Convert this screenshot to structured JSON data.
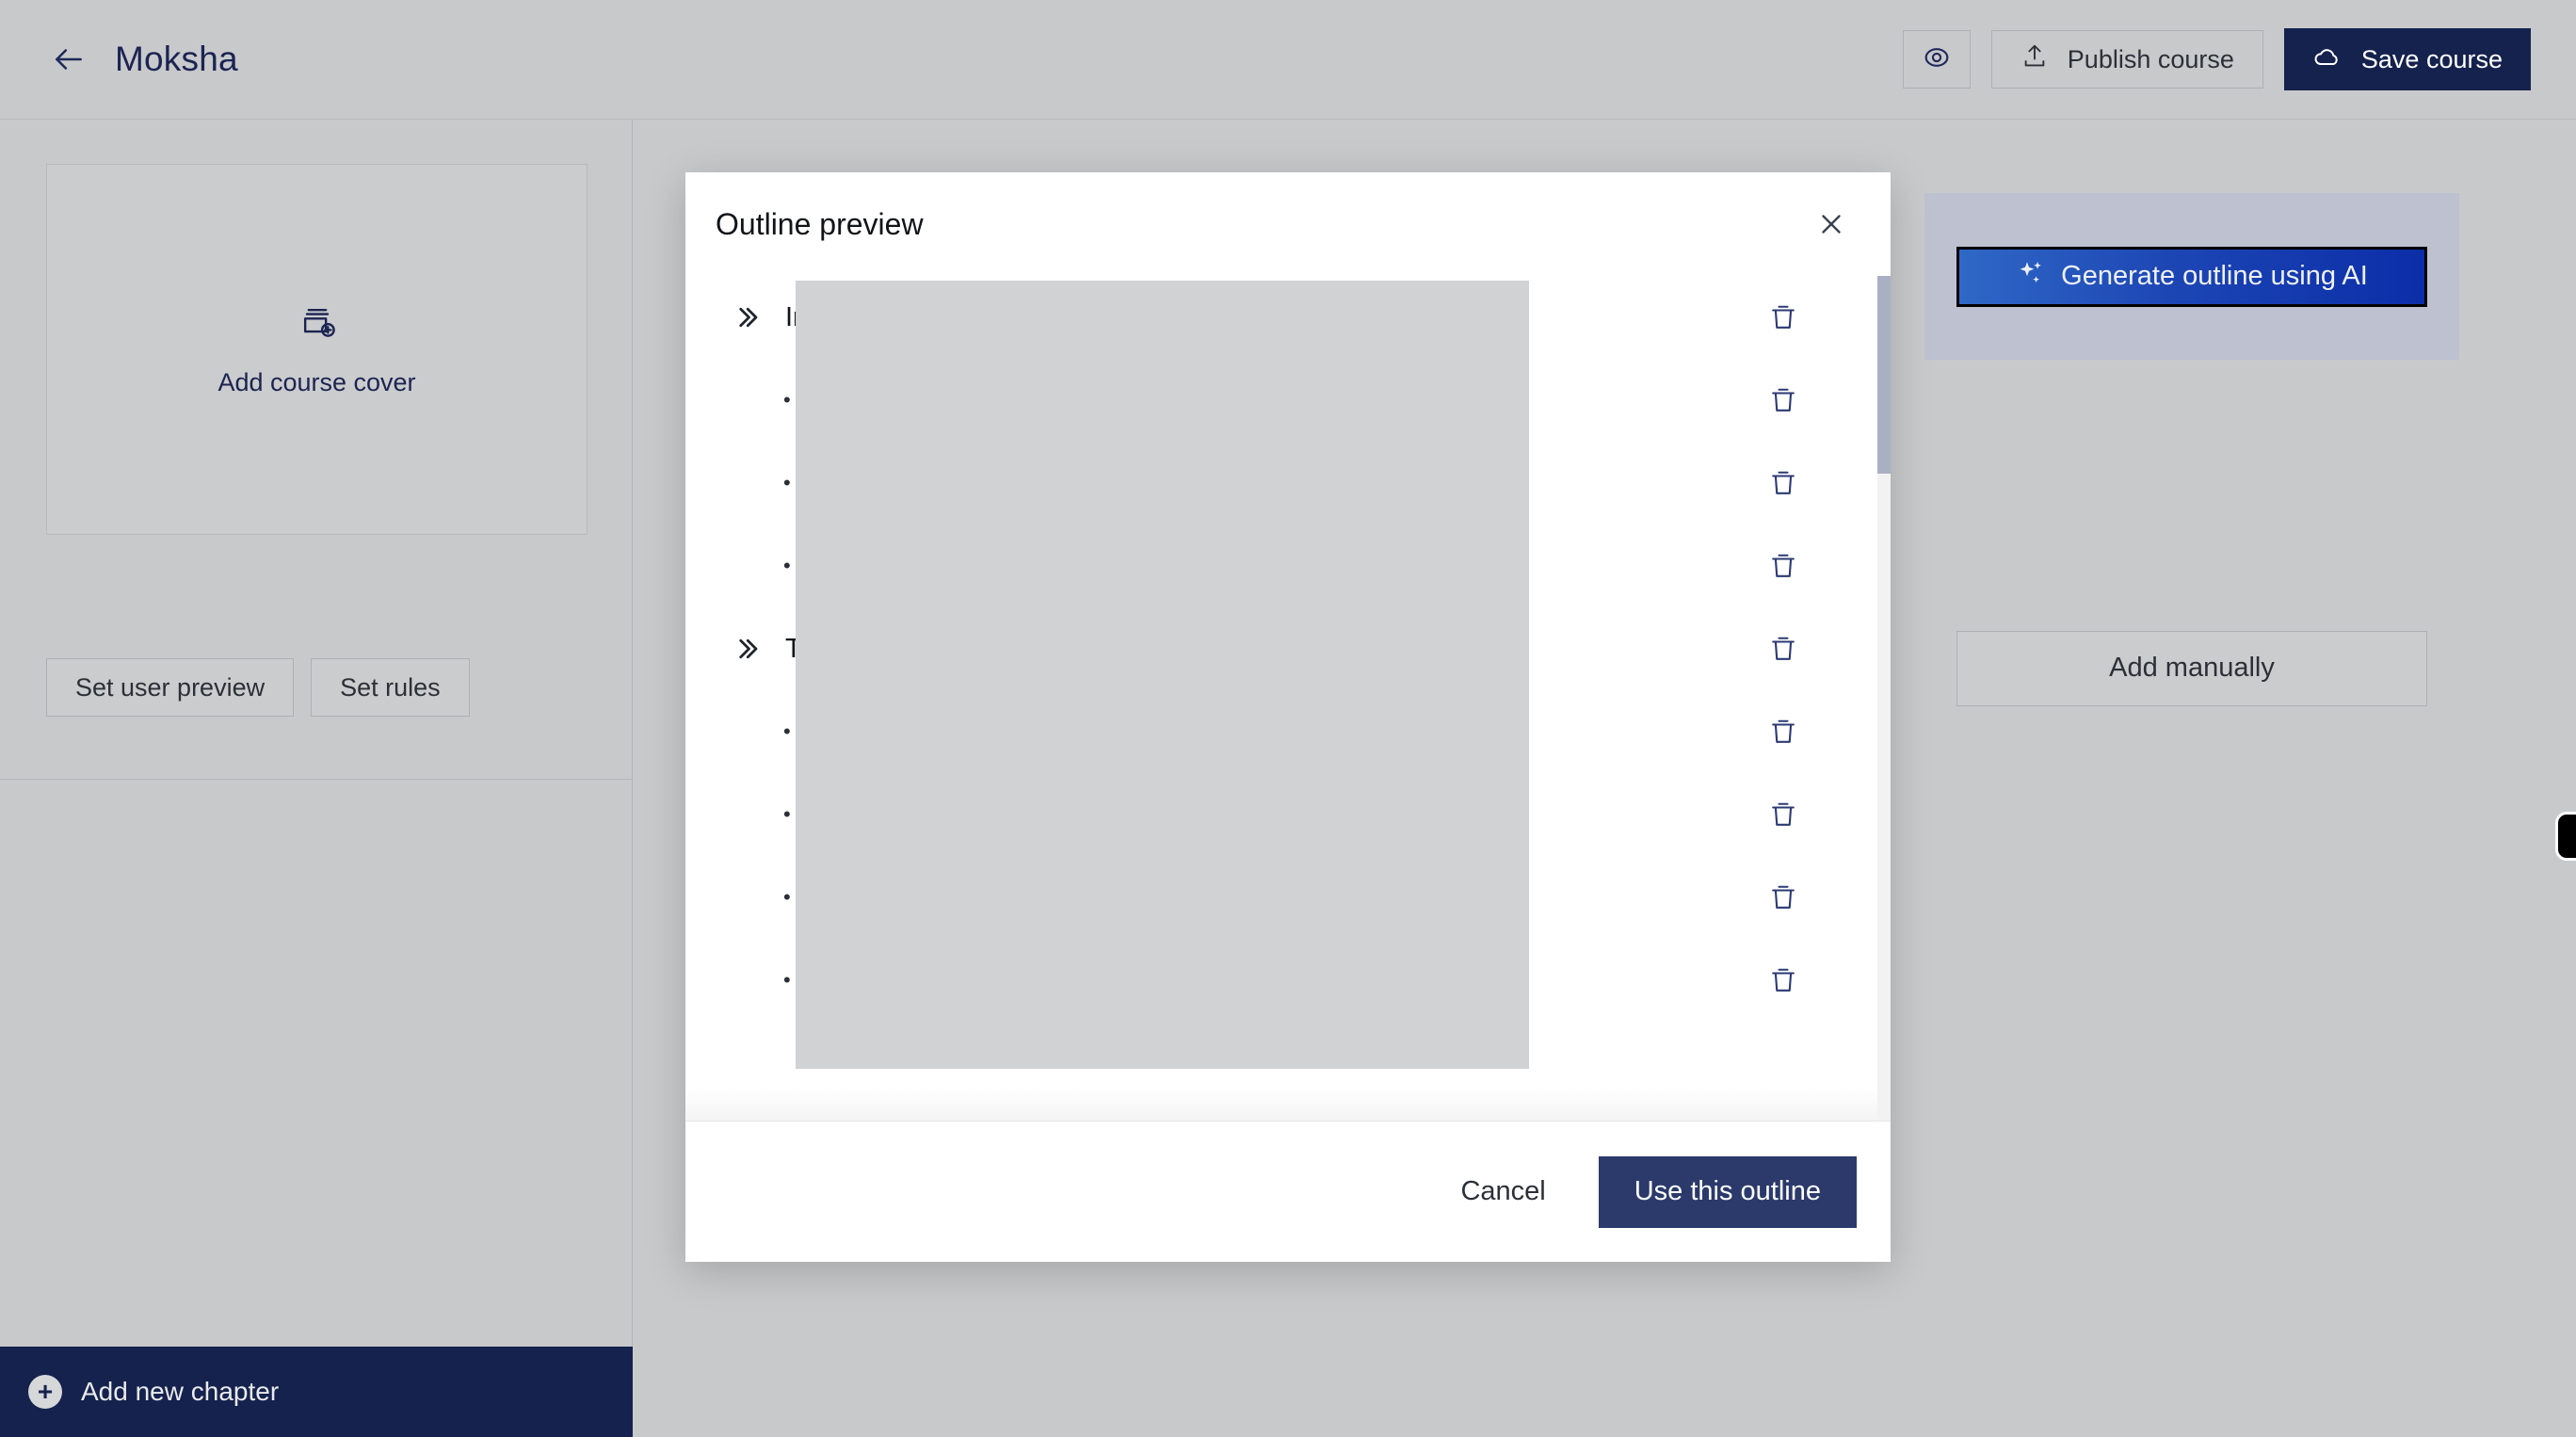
{
  "topbar": {
    "back_icon": "arrow-left-icon",
    "title": "Moksha",
    "preview_icon": "eye-icon",
    "publish_label": "Publish course",
    "publish_icon": "upload-icon",
    "save_label": "Save course",
    "save_icon": "cloud-icon",
    "save_bg": "#15224e"
  },
  "sidebar": {
    "cover_label": "Add course cover",
    "cover_icon": "image-stack-plus-icon",
    "set_user_preview_label": "Set user preview",
    "set_rules_label": "Set rules",
    "add_chapter_label": "Add new chapter",
    "add_chapter_icon": "plus-circle-icon",
    "add_chapter_bg": "#15224e"
  },
  "content": {
    "generate_label": "Generate outline using AI",
    "generate_icon": "sparkles-icon",
    "generate_gradient_from": "#2f68c6",
    "generate_gradient_to": "#0b2ea8",
    "add_manually_label": "Add manually",
    "edge_tab_icon": "panel-handle-icon"
  },
  "modal": {
    "title": "Outline preview",
    "close_icon": "close-icon",
    "cancel_label": "Cancel",
    "use_label": "Use this outline",
    "use_bg": "#2b3a6b",
    "delete_icon": "trash-icon",
    "expand_icon": "chevron-double-right-icon",
    "bullet_glyph": "•",
    "rows": [
      {
        "type": "chapter",
        "text": "In"
      },
      {
        "type": "lesson",
        "text": ""
      },
      {
        "type": "lesson",
        "text": ""
      },
      {
        "type": "lesson",
        "text": ""
      },
      {
        "type": "chapter",
        "text": "T"
      },
      {
        "type": "lesson",
        "text": ""
      },
      {
        "type": "lesson",
        "text": ""
      },
      {
        "type": "lesson",
        "text": ""
      },
      {
        "type": "lesson",
        "text": ""
      }
    ]
  }
}
